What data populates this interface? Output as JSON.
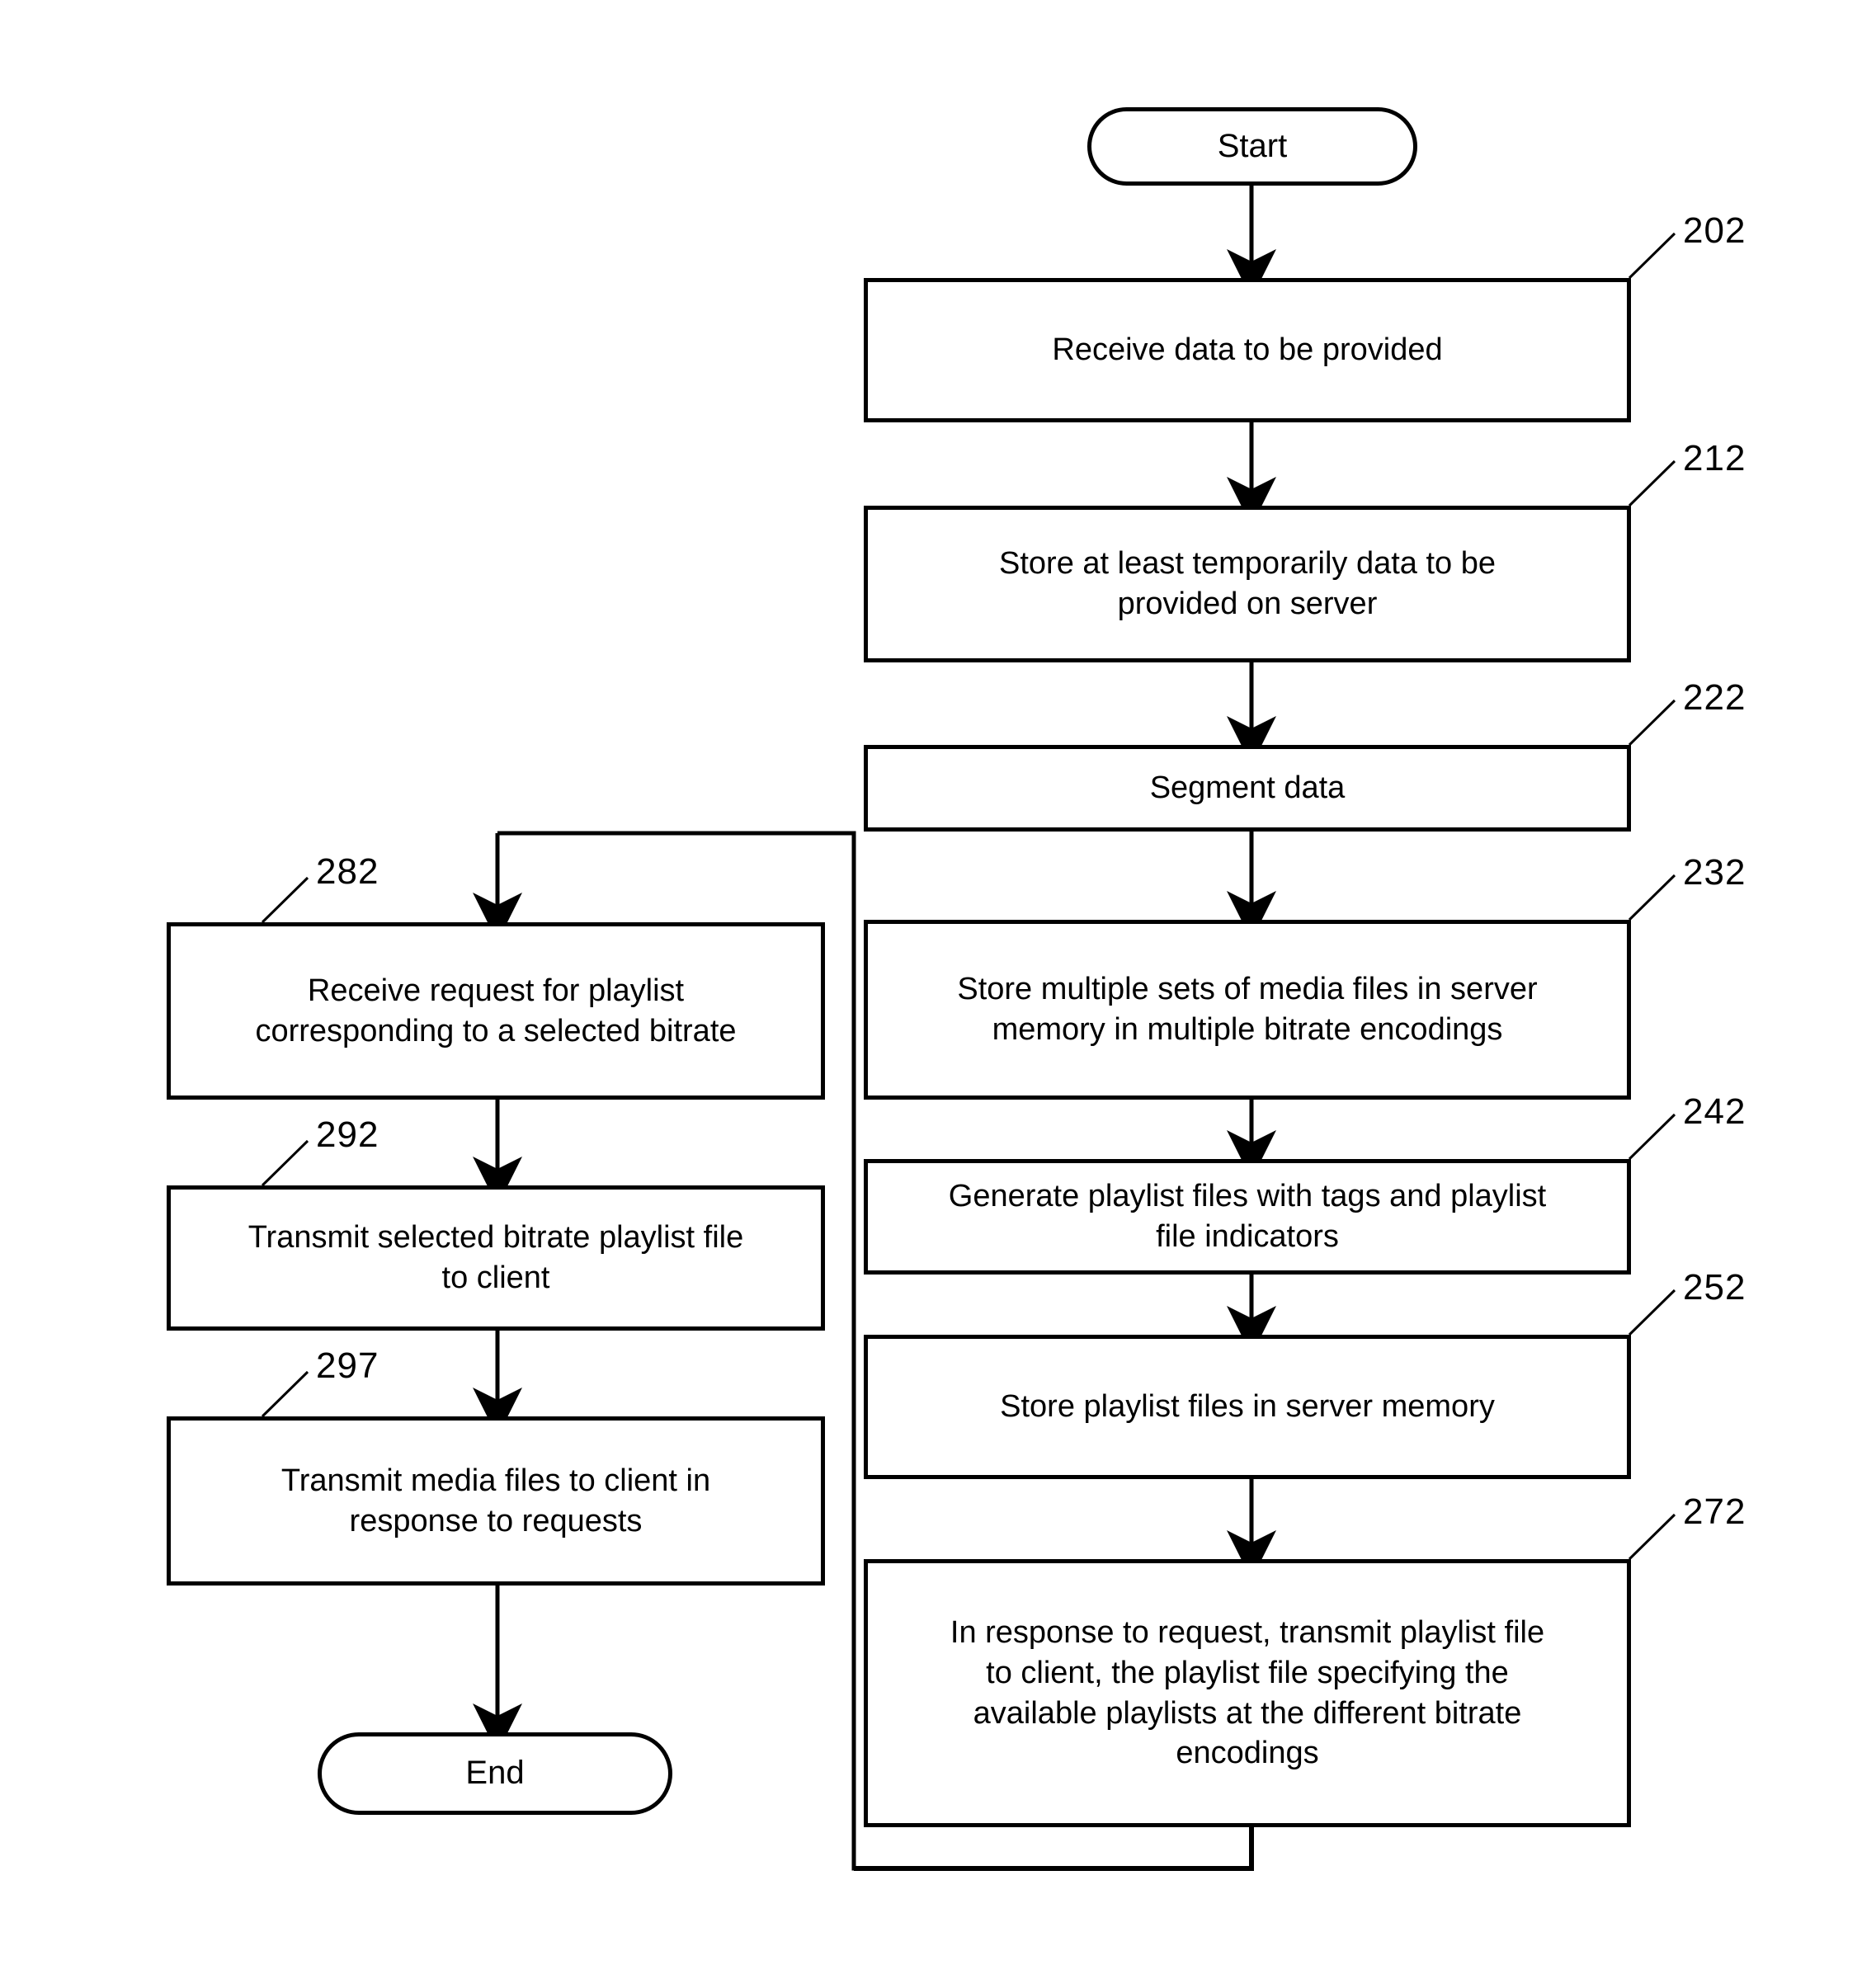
{
  "figure": {
    "type": "flowchart",
    "orientation": "two-column",
    "background_color": "#ffffff",
    "line_color": "#000000"
  },
  "nodes": {
    "start": {
      "label": "Start",
      "shape": "terminator",
      "ref": ""
    },
    "end": {
      "label": "End",
      "shape": "terminator",
      "ref": ""
    },
    "n202": {
      "label": "Receive data to be provided",
      "shape": "process",
      "ref": "202"
    },
    "n212": {
      "label": "Store at least temporarily data to be\nprovided on server",
      "shape": "process",
      "ref": "212"
    },
    "n222": {
      "label": "Segment data",
      "shape": "process",
      "ref": "222"
    },
    "n232": {
      "label": "Store multiple sets of media files in server\nmemory in multiple bitrate encodings",
      "shape": "process",
      "ref": "232"
    },
    "n242": {
      "label": "Generate playlist files with tags and playlist\nfile indicators",
      "shape": "process",
      "ref": "242"
    },
    "n252": {
      "label": "Store playlist files in server memory",
      "shape": "process",
      "ref": "252"
    },
    "n272": {
      "label": "In response to request, transmit playlist file\nto client, the playlist file specifying the\navailable playlists at the different bitrate\nencodings",
      "shape": "process",
      "ref": "272"
    },
    "n282": {
      "label": "Receive request for playlist\ncorresponding to a selected bitrate",
      "shape": "process",
      "ref": "282"
    },
    "n292": {
      "label": "Transmit selected bitrate playlist file\nto client",
      "shape": "process",
      "ref": "292"
    },
    "n297": {
      "label": "Transmit media files to client in\nresponse to requests",
      "shape": "process",
      "ref": "297"
    }
  },
  "edges": [
    {
      "from": "start",
      "to": "n202",
      "kind": "arrow-down"
    },
    {
      "from": "n202",
      "to": "n212",
      "kind": "arrow-down"
    },
    {
      "from": "n212",
      "to": "n222",
      "kind": "arrow-down"
    },
    {
      "from": "n222",
      "to": "n232",
      "kind": "arrow-down"
    },
    {
      "from": "n232",
      "to": "n242",
      "kind": "arrow-down"
    },
    {
      "from": "n242",
      "to": "n252",
      "kind": "arrow-down"
    },
    {
      "from": "n252",
      "to": "n272",
      "kind": "arrow-down"
    },
    {
      "from": "n272",
      "to": "n282",
      "kind": "loop-back-left"
    },
    {
      "from": "n282",
      "to": "n292",
      "kind": "arrow-down"
    },
    {
      "from": "n292",
      "to": "n297",
      "kind": "arrow-down"
    },
    {
      "from": "n297",
      "to": "end",
      "kind": "arrow-down"
    }
  ]
}
